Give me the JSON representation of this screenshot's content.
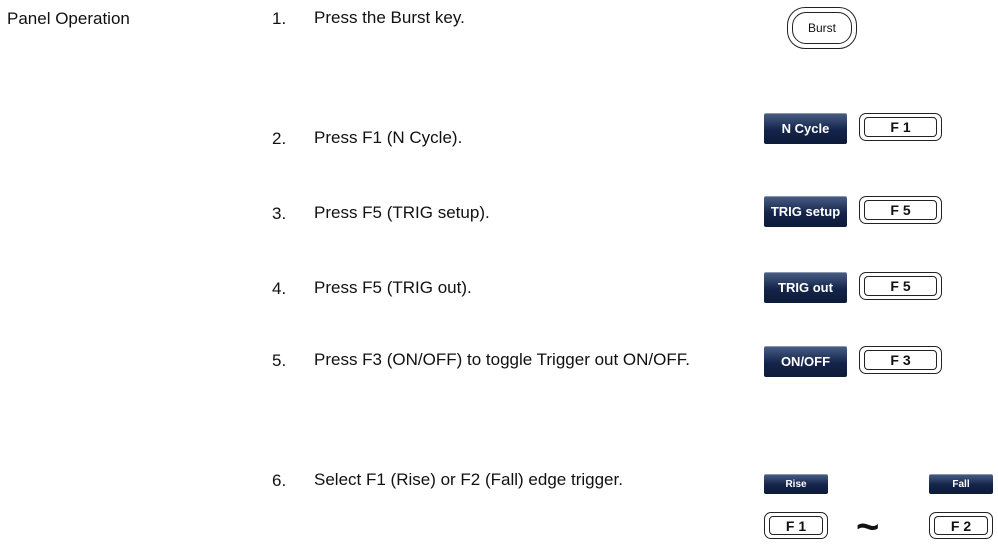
{
  "section_label": "Panel Operation",
  "steps": [
    {
      "num": "1.",
      "text": "Press the Burst key."
    },
    {
      "num": "2.",
      "text": "Press F1 (N Cycle)."
    },
    {
      "num": "3.",
      "text": "Press F5 (TRIG setup)."
    },
    {
      "num": "4.",
      "text": "Press F5 (TRIG out)."
    },
    {
      "num": "5.",
      "text": "Press F3 (ON/OFF) to toggle Trigger out ON/OFF."
    },
    {
      "num": "6.",
      "text": "Select F1 (Rise) or F2 (Fall) edge trigger."
    }
  ],
  "keys": {
    "burst": "Burst",
    "n_cycle": "N Cycle",
    "trig_setup": "TRIG setup",
    "trig_out": "TRIG out",
    "on_off": "ON/OFF",
    "rise": "Rise",
    "fall": "Fall",
    "f1": "F 1",
    "f2": "F 2",
    "f3": "F 3",
    "f5": "F 5"
  },
  "tilde": "~",
  "colors": {
    "softkey": "#1a2b52",
    "text": "#111111"
  }
}
